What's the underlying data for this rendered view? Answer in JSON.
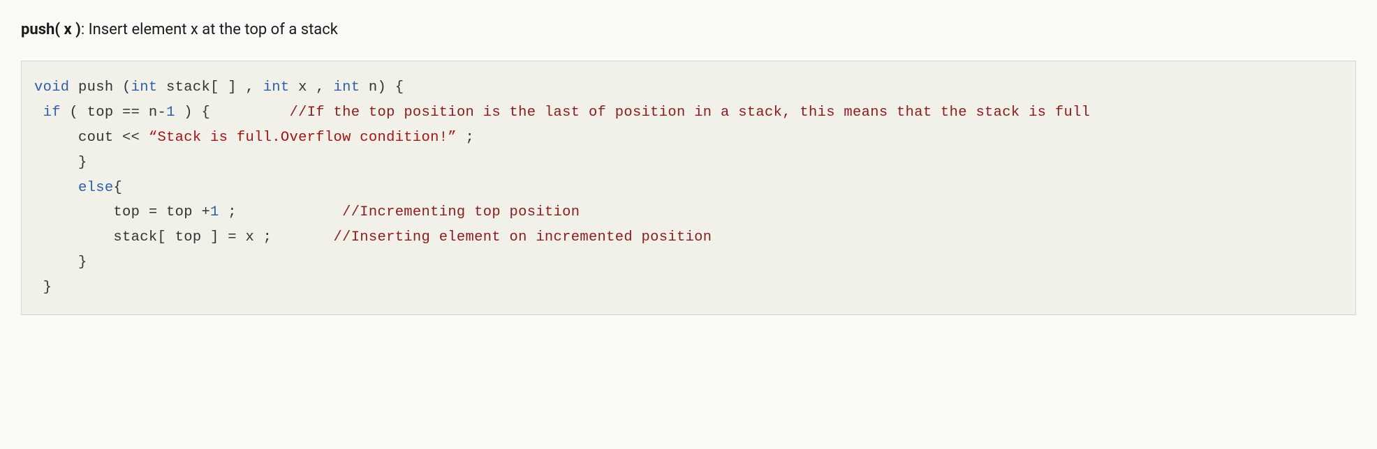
{
  "description": {
    "heading": "push( x )",
    "text": ": Insert element x at the top of a stack"
  },
  "code": {
    "line1_a": "void",
    "line1_b": " push (",
    "line1_c": "int",
    "line1_d": " stack[ ] , ",
    "line1_e": "int",
    "line1_f": " x , ",
    "line1_g": "int",
    "line1_h": " n) {",
    "line2_a": " if",
    "line2_b": " ( top == n-",
    "line2_c": "1",
    "line2_d": " ) {         ",
    "line2_e": "//If the top position is the last of position in a stack, this means that the stack is full",
    "line3_a": "     cout << ",
    "line3_b": "“Stack is full.Overflow condition!”",
    "line3_c": " ;",
    "line4": "     }",
    "line5_a": "     else",
    "line5_b": "{",
    "line6_a": "         top = top +",
    "line6_b": "1",
    "line6_c": " ;            ",
    "line6_d": "//Incrementing top position ",
    "line7_a": "         stack[ top ] = x ;       ",
    "line7_b": "//Inserting element on incremented position  ",
    "line8": "     }",
    "line9": " }"
  }
}
